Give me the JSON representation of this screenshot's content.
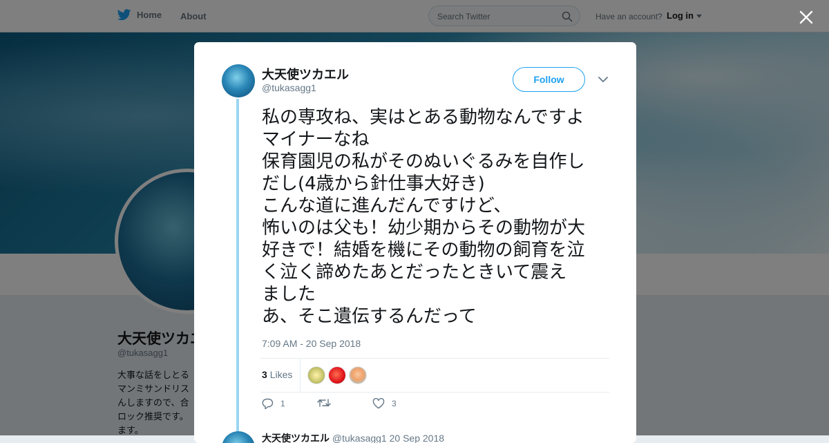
{
  "nav": {
    "home_label": "Home",
    "about_label": "About",
    "search_placeholder": "Search Twitter",
    "account_prompt": "Have an account?",
    "login_label": "Log in",
    "brand_color": "#1da1f2"
  },
  "profile": {
    "name": "大天使ツカエル",
    "handle": "@tukasagg1",
    "bio": "大事な話をしとる\nマンミサンドリス\nんしますので、合\nロック推奨です。\nます。"
  },
  "tweet": {
    "author_name": "大天使ツカエル",
    "author_handle": "@tukasagg1",
    "follow_label": "Follow",
    "lines": [
      "私の専攻ね、実はとある動物なんですよ",
      "マイナーなね",
      "保育園児の私がそのぬいぐるみを自作し",
      "だし(4歳から針仕事大好き)",
      "こんな道に進んだんですけど、",
      "怖いのは父も！幼少期からその動物が大",
      "好きで！結婚を機にその動物の飼育を泣",
      "く泣く諦めたあとだったときいて震え",
      "ました",
      "あ、そこ遺伝するんだって"
    ],
    "timestamp": "7:09 AM - 20 Sep 2018",
    "likes_count": "3",
    "likes_label": "Likes",
    "reply_count": "1",
    "retweet_count": "",
    "like_count": "3"
  },
  "next_tweet": {
    "author_name": "大天使ツカエル",
    "author_handle": "@tukasagg1",
    "date": "20 Sep 2018"
  }
}
